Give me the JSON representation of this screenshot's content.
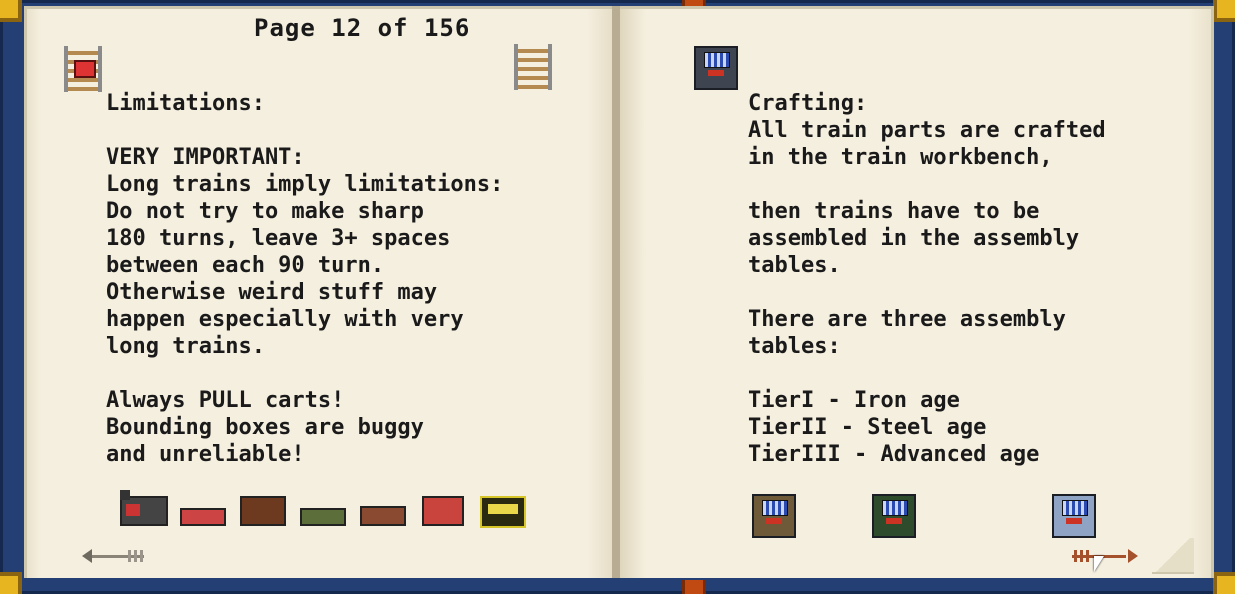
{
  "book": {
    "page_number": "Page 12 of 156"
  },
  "left_page": {
    "text": "Limitations:\n\nVERY IMPORTANT:\nLong trains imply limitations:\nDo not try to make sharp\n180 turns, leave 3+ spaces\nbetween each 90 turn.\nOtherwise weird stuff may\nhappen especially with very\nlong trains.\n\nAlways PULL carts!\nBounding boxes are buggy\nand unreliable!",
    "header_icons": [
      "rail-with-red-icon",
      "rail-icon"
    ],
    "bottom_icons": [
      "locomotive-icon",
      "red-flatcar-icon",
      "boxcar-icon",
      "green-flatcar-icon",
      "gondola-icon",
      "red-tankcar-icon",
      "caboose-icon"
    ]
  },
  "right_page": {
    "text": "Crafting:\nAll train parts are crafted\nin the train workbench,\n\nthen trains have to be\nassembled in the assembly\ntables.\n\nThere are three assembly\ntables:\n\nTierI - Iron age\nTierII - Steel age\nTierIII - Advanced age",
    "header_icons": [
      "train-workbench-icon"
    ],
    "bottom_icons": [
      "assembly-table-tier1-icon",
      "assembly-table-tier2-icon",
      "assembly-table-tier3-icon"
    ]
  },
  "navigation": {
    "prev": "previous-page-arrow",
    "next": "next-page-arrow"
  },
  "colors": {
    "cover": "#243f74",
    "page": "#f4eedd",
    "text": "#1a1a1a",
    "ribbon": "#c04a12",
    "corner": "#e6b520"
  }
}
